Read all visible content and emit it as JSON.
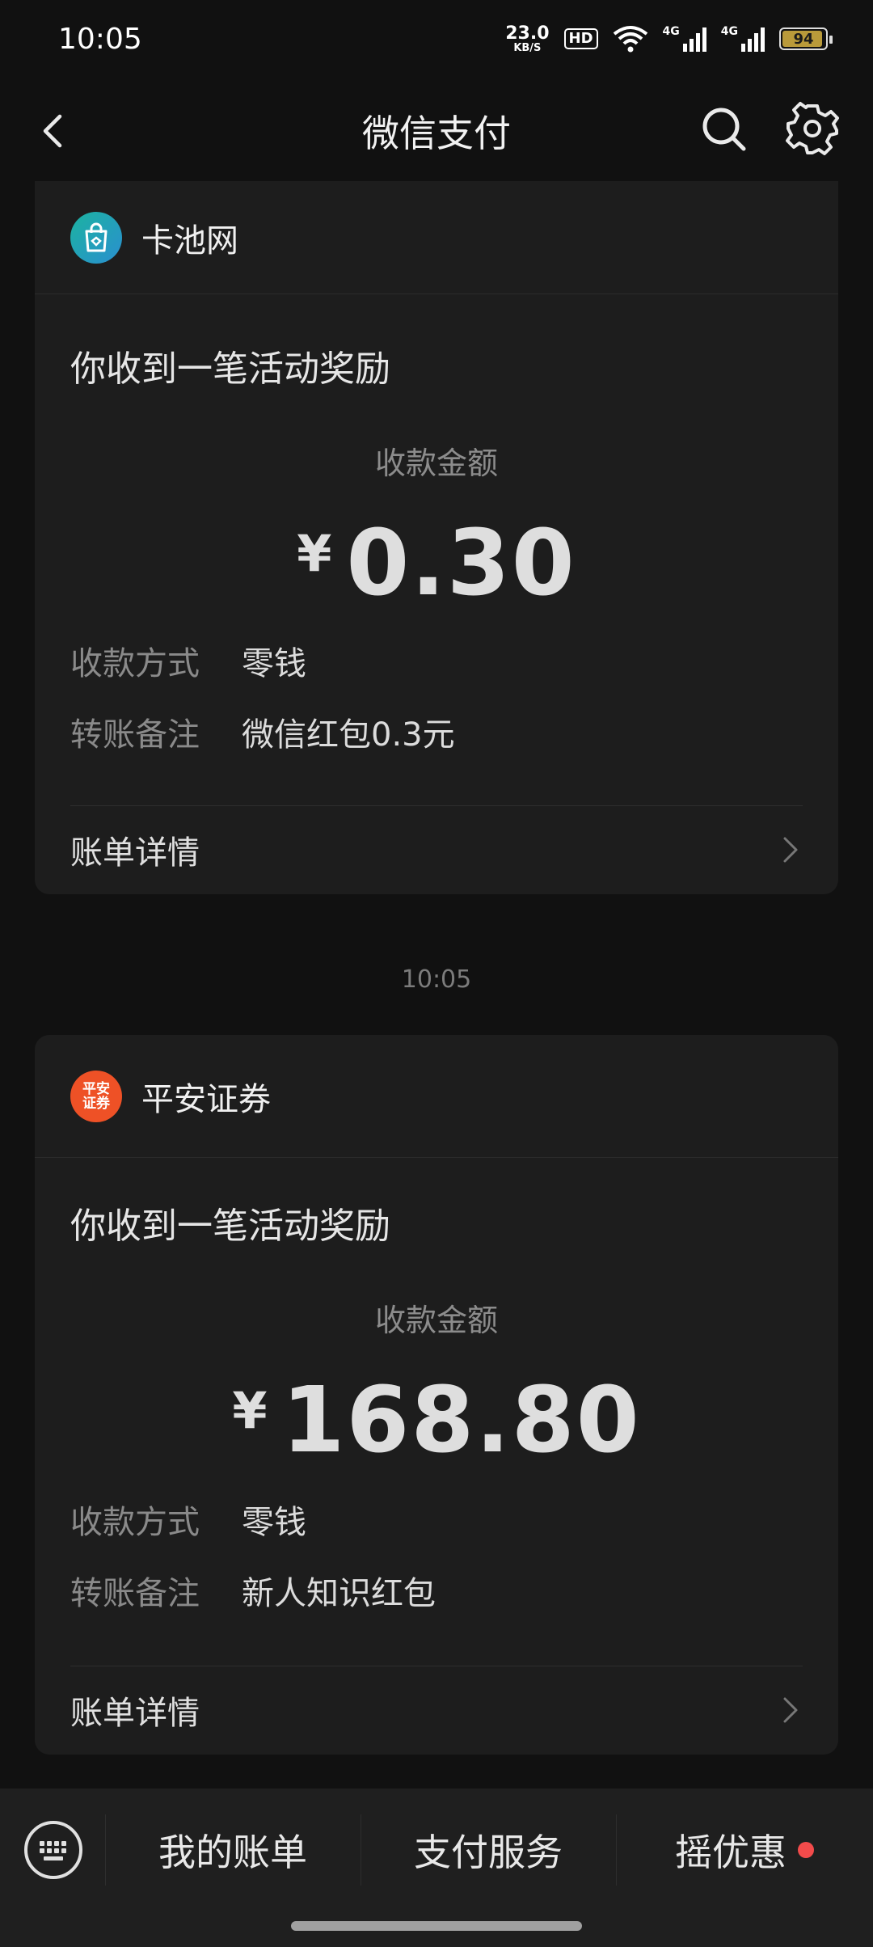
{
  "status_bar": {
    "time": "10:05",
    "net_speed": "23.0",
    "net_speed_unit": "KB/S",
    "hd_label": "HD",
    "network_1": "4G",
    "network_2": "4G",
    "battery": "94",
    "battery_level": 0.94
  },
  "header": {
    "title": "微信支付",
    "icons": [
      "back-icon",
      "search-icon",
      "gear-icon"
    ]
  },
  "messages": [
    {
      "merchant": "卡池网",
      "headline": "你收到一笔活动奖励",
      "amount_label": "收款金额",
      "currency": "¥",
      "amount": "0.30",
      "rows": [
        {
          "key": "收款方式",
          "value": "零钱"
        },
        {
          "key": "转账备注",
          "value": "微信红包0.3元"
        }
      ],
      "bill_label": "账单详情"
    },
    {
      "timestamp": "10:05",
      "merchant": "平安证券",
      "logo_text": "平安证券",
      "headline": "你收到一笔活动奖励",
      "amount_label": "收款金额",
      "currency": "¥",
      "amount": "168.80",
      "rows": [
        {
          "key": "收款方式",
          "value": "零钱"
        },
        {
          "key": "转账备注",
          "value": "新人知识红包"
        }
      ],
      "bill_label": "账单详情"
    }
  ],
  "bottom_menu": {
    "items": [
      "我的账单",
      "支付服务",
      "摇优惠"
    ]
  },
  "colors": {
    "background": "#111111",
    "card": "#1d1d1d",
    "kachi_logo": "#1aa89a",
    "pingan_logo": "#ee5126",
    "red_dot": "#f24b4b"
  }
}
